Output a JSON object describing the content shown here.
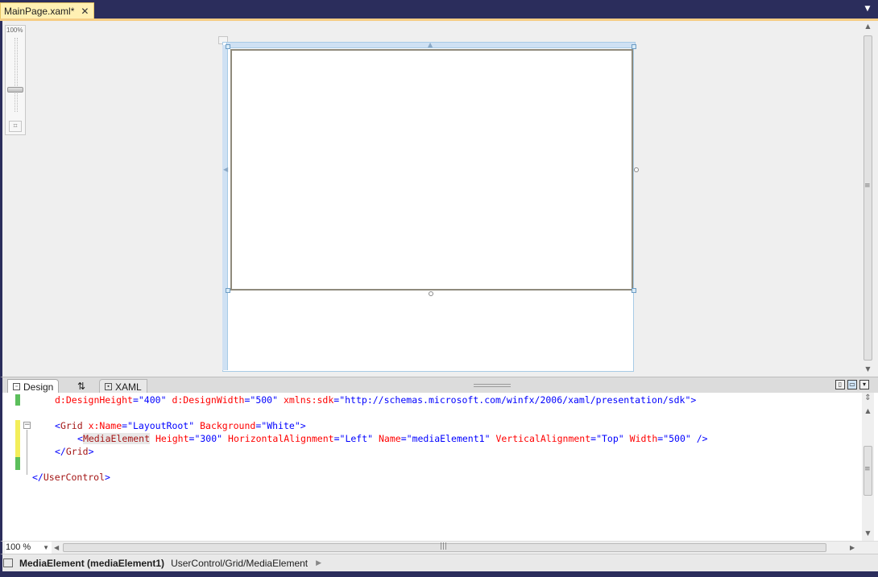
{
  "document_tab": {
    "label": "MainPage.xaml*",
    "close_glyph": "✕"
  },
  "tab_menu_glyph": "▼",
  "zoom_slider": {
    "label": "100%"
  },
  "view_tabs": {
    "design": "Design",
    "swap": "⇅",
    "xaml": "XAML"
  },
  "xaml_lines": [
    {
      "parts": [
        {
          "t": "d:DesignHeight",
          "c": "attr"
        },
        {
          "t": "=\"",
          "c": "pun"
        },
        {
          "t": "400",
          "c": "val"
        },
        {
          "t": "\" ",
          "c": "pun"
        },
        {
          "t": "d:DesignWidth",
          "c": "attr"
        },
        {
          "t": "=\"",
          "c": "pun"
        },
        {
          "t": "500",
          "c": "val"
        },
        {
          "t": "\" ",
          "c": "pun"
        },
        {
          "t": "xmlns:sdk",
          "c": "attr"
        },
        {
          "t": "=\"",
          "c": "pun"
        },
        {
          "t": "http://schemas.microsoft.com/winfx/2006/xaml/presentation/sdk",
          "c": "val"
        },
        {
          "t": "\">",
          "c": "pun"
        }
      ],
      "indent": 1
    },
    {
      "parts": [],
      "indent": 0
    },
    {
      "parts": [
        {
          "t": "<",
          "c": "pun"
        },
        {
          "t": "Grid",
          "c": "tag"
        },
        {
          "t": " ",
          "c": "pun"
        },
        {
          "t": "x:Name",
          "c": "attr"
        },
        {
          "t": "=\"",
          "c": "pun"
        },
        {
          "t": "LayoutRoot",
          "c": "val"
        },
        {
          "t": "\" ",
          "c": "pun"
        },
        {
          "t": "Background",
          "c": "attr"
        },
        {
          "t": "=\"",
          "c": "pun"
        },
        {
          "t": "White",
          "c": "val"
        },
        {
          "t": "\">",
          "c": "pun"
        }
      ],
      "indent": 1
    },
    {
      "parts": [
        {
          "t": "<",
          "c": "pun"
        },
        {
          "t": "MediaElement",
          "c": "tag hl"
        },
        {
          "t": " ",
          "c": "pun"
        },
        {
          "t": "Height",
          "c": "attr"
        },
        {
          "t": "=\"",
          "c": "pun"
        },
        {
          "t": "300",
          "c": "val"
        },
        {
          "t": "\" ",
          "c": "pun"
        },
        {
          "t": "HorizontalAlignment",
          "c": "attr"
        },
        {
          "t": "=\"",
          "c": "pun"
        },
        {
          "t": "Left",
          "c": "val"
        },
        {
          "t": "\" ",
          "c": "pun"
        },
        {
          "t": "Name",
          "c": "attr"
        },
        {
          "t": "=\"",
          "c": "pun"
        },
        {
          "t": "mediaElement1",
          "c": "val"
        },
        {
          "t": "\" ",
          "c": "pun"
        },
        {
          "t": "VerticalAlignment",
          "c": "attr"
        },
        {
          "t": "=\"",
          "c": "pun"
        },
        {
          "t": "Top",
          "c": "val"
        },
        {
          "t": "\" ",
          "c": "pun"
        },
        {
          "t": "Width",
          "c": "attr"
        },
        {
          "t": "=\"",
          "c": "pun"
        },
        {
          "t": "500",
          "c": "val"
        },
        {
          "t": "\" />",
          "c": "pun"
        }
      ],
      "indent": 2
    },
    {
      "parts": [
        {
          "t": "</",
          "c": "pun"
        },
        {
          "t": "Grid",
          "c": "tag"
        },
        {
          "t": ">",
          "c": "pun"
        }
      ],
      "indent": 1
    },
    {
      "parts": [],
      "indent": 0
    },
    {
      "parts": [
        {
          "t": "</",
          "c": "pun"
        },
        {
          "t": "UserControl",
          "c": "tag"
        },
        {
          "t": ">",
          "c": "pun"
        }
      ],
      "indent": 0
    }
  ],
  "zoom_combo": {
    "value": "100 %"
  },
  "status": {
    "element": "MediaElement (mediaElement1)",
    "path": "UserControl/Grid/MediaElement"
  },
  "colors": {
    "frame": "#2b2d5c",
    "accent": "#f5cc84",
    "tab_active": "#fff0b3"
  }
}
